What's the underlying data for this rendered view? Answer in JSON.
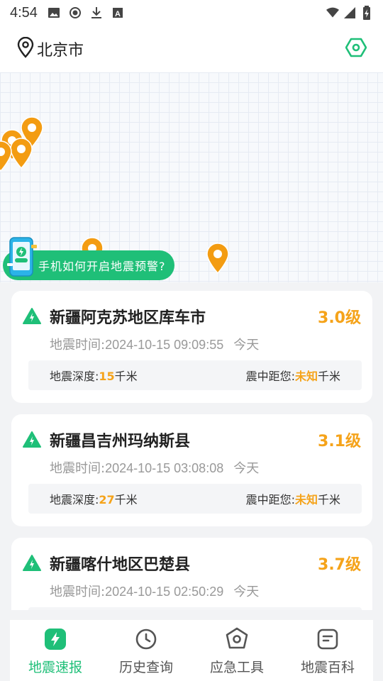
{
  "status_bar": {
    "time": "4:54",
    "icons_left": [
      "image-icon",
      "record-icon",
      "download-icon",
      "font-icon"
    ],
    "icons_right": [
      "wifi-icon",
      "signal-icon",
      "battery-icon"
    ]
  },
  "header": {
    "city": "北京市",
    "location_icon": "location-pin-icon",
    "settings_icon": "hexagon-settings-icon"
  },
  "map": {
    "pin_color": "#f39c12",
    "warning_banner": "手机如何开启地震预警?"
  },
  "quakes": [
    {
      "place": "新疆阿克苏地区库车市",
      "magnitude": "3.0级",
      "time_label": "地震时间:",
      "time": "2024-10-15 09:09:55",
      "day": "今天",
      "depth_label": "地震深度:",
      "depth_value": "15",
      "depth_unit": "千米",
      "distance_label": "震中距您:",
      "distance_value": "未知",
      "distance_unit": "千米"
    },
    {
      "place": "新疆昌吉州玛纳斯县",
      "magnitude": "3.1级",
      "time_label": "地震时间:",
      "time": "2024-10-15 03:08:08",
      "day": "今天",
      "depth_label": "地震深度:",
      "depth_value": "27",
      "depth_unit": "千米",
      "distance_label": "震中距您:",
      "distance_value": "未知",
      "distance_unit": "千米"
    },
    {
      "place": "新疆喀什地区巴楚县",
      "magnitude": "3.7级",
      "time_label": "地震时间:",
      "time": "2024-10-15 02:50:29",
      "day": "今天"
    }
  ],
  "nav": [
    {
      "label": "地震速报",
      "icon": "lightning-icon",
      "active": true
    },
    {
      "label": "历史查询",
      "icon": "clock-icon",
      "active": false
    },
    {
      "label": "应急工具",
      "icon": "hexagon-tool-icon",
      "active": false
    },
    {
      "label": "地震百科",
      "icon": "book-icon",
      "active": false
    }
  ],
  "colors": {
    "accent": "#1fbf78",
    "magnitude": "#f5a31a"
  }
}
